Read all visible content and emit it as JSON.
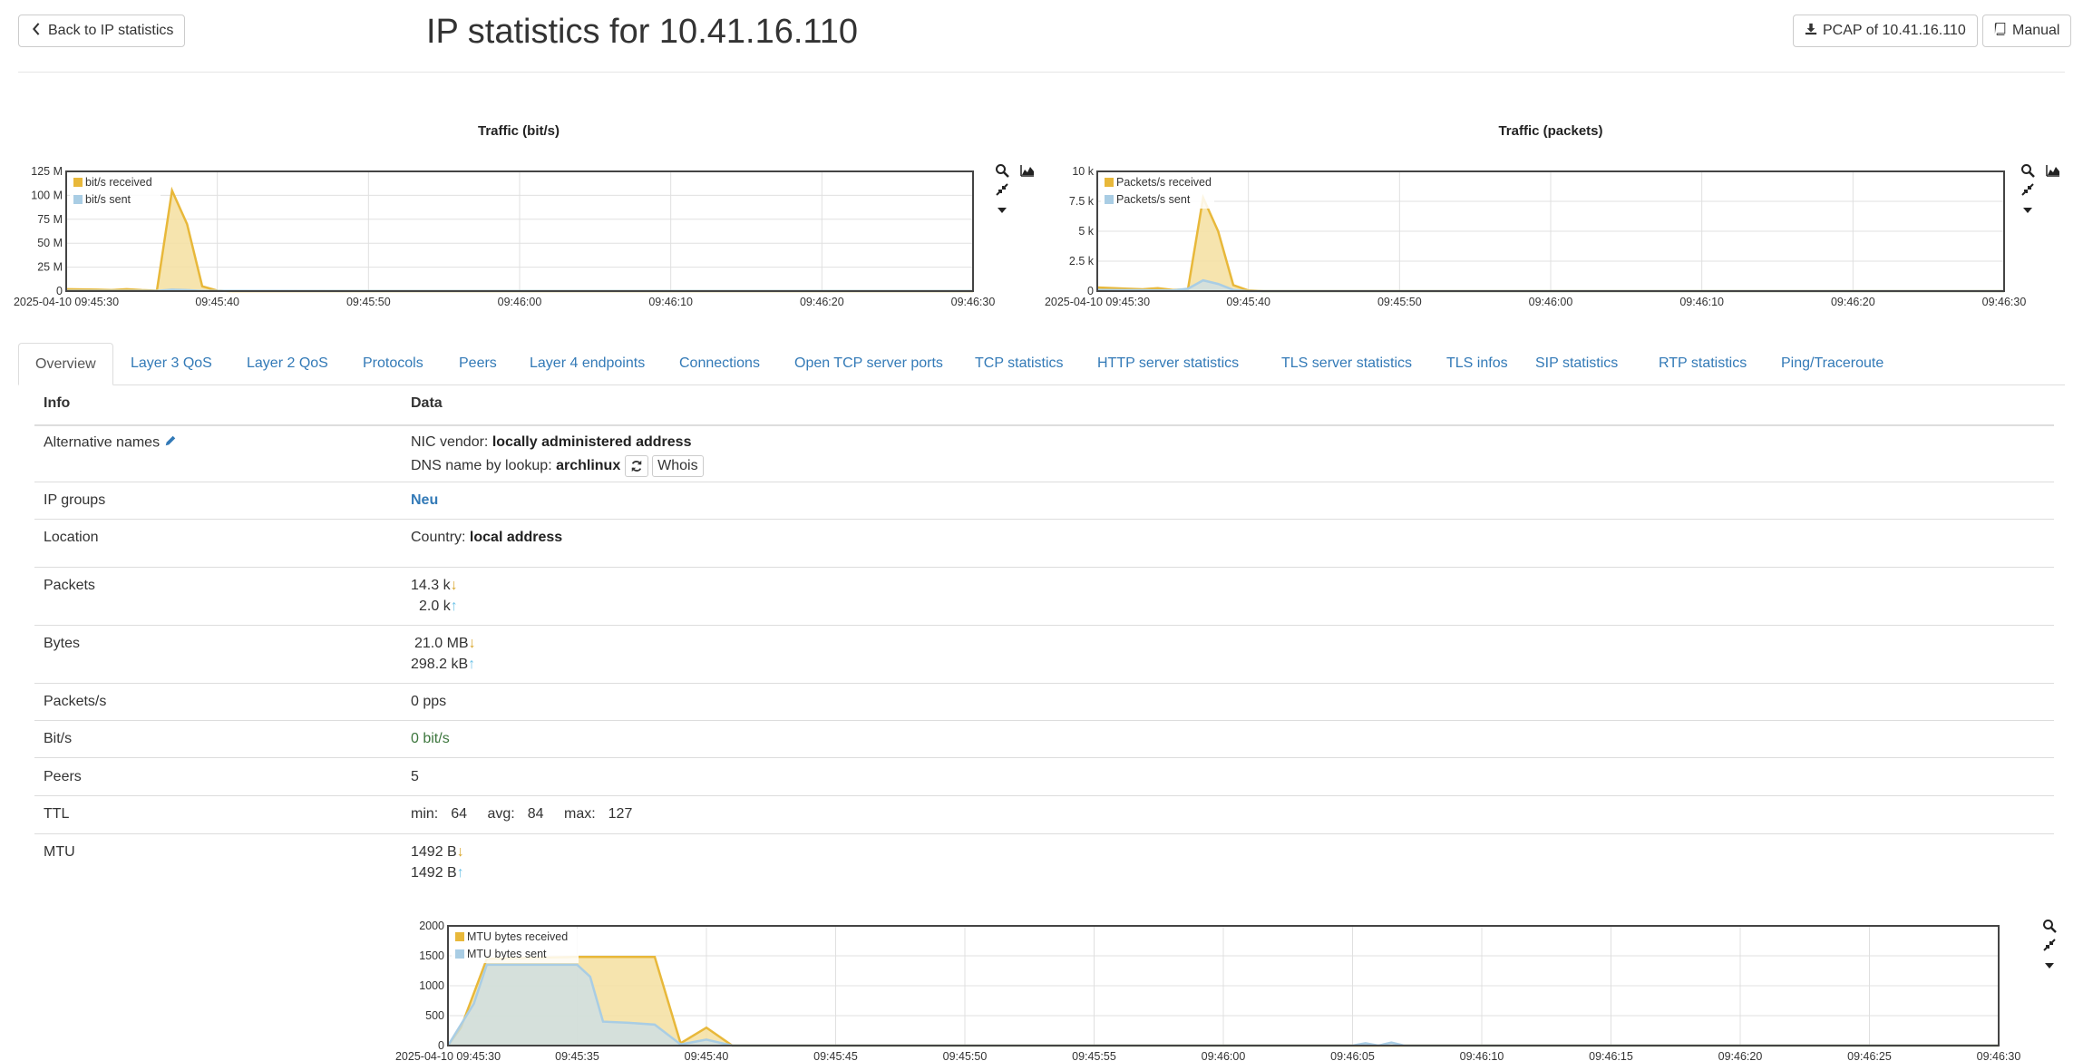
{
  "header": {
    "back_label": "Back to IP statistics",
    "title": "IP statistics for 10.41.16.110",
    "pcap_label": "PCAP of 10.41.16.110",
    "manual_label": "Manual"
  },
  "tabs": [
    {
      "label": "Overview",
      "active": true
    },
    {
      "label": "Layer 3 QoS"
    },
    {
      "label": "Layer 2 QoS"
    },
    {
      "label": "Protocols"
    },
    {
      "label": "Peers"
    },
    {
      "label": "Layer 4 endpoints"
    },
    {
      "label": "Connections"
    },
    {
      "label": "Open TCP server ports"
    },
    {
      "label": "TCP statistics"
    },
    {
      "label": "HTTP server statistics"
    },
    {
      "label": "TLS server statistics"
    },
    {
      "label": "TLS infos"
    },
    {
      "label": "SIP statistics"
    },
    {
      "label": "RTP statistics"
    },
    {
      "label": "Ping/Traceroute"
    }
  ],
  "table": {
    "head_info": "Info",
    "head_data": "Data",
    "alt_names": {
      "label": "Alternative names",
      "nic_prefix": "NIC vendor:",
      "nic_value": "locally administered address",
      "dns_prefix": "DNS name by lookup:",
      "dns_value": "archlinux",
      "whois_label": "Whois"
    },
    "ip_groups": {
      "label": "IP groups",
      "value": "Neu"
    },
    "location": {
      "label": "Location",
      "prefix": "Country:",
      "value": "local address"
    },
    "packets": {
      "label": "Packets",
      "received": "14.3 k",
      "sent": "2.0 k"
    },
    "bytes": {
      "label": "Bytes",
      "received": "21.0 MB",
      "sent": "298.2 kB"
    },
    "packets_per_s": {
      "label": "Packets/s",
      "value": "0 pps"
    },
    "bits_per_s": {
      "label": "Bit/s",
      "value": "0 bit/s"
    },
    "peers": {
      "label": "Peers",
      "value": "5"
    },
    "ttl": {
      "label": "TTL",
      "min_label": "min:",
      "min": "64",
      "avg_label": "avg:",
      "avg": "84",
      "max_label": "max:",
      "max": "127"
    },
    "mtu": {
      "label": "MTU",
      "received": "1492 B",
      "sent": "1492 B"
    }
  },
  "colors": {
    "received": "#e8b83a",
    "received_fill": "#f5dfa0",
    "sent": "#a9cde4",
    "sent_fill": "#c9dfea",
    "link": "#337ab7"
  },
  "chart_data": [
    {
      "type": "area",
      "title": "Traffic (bit/s)",
      "x_tick_labels": [
        "2025-04-10 09:45:30",
        "09:45:40",
        "09:45:50",
        "09:46:00",
        "09:46:10",
        "09:46:20",
        "09:46:30"
      ],
      "y_tick_labels": [
        "0",
        "25 M",
        "50 M",
        "75 M",
        "100 M",
        "125 M"
      ],
      "ylim": [
        0,
        125000000
      ],
      "x_seconds_range": [
        0,
        60
      ],
      "series": [
        {
          "name": "bit/s received",
          "color": "#e8b83a",
          "points": [
            [
              0,
              2000000
            ],
            [
              2,
              1500000
            ],
            [
              3,
              1000000
            ],
            [
              4,
              2000000
            ],
            [
              5,
              1000000
            ],
            [
              6,
              500000
            ],
            [
              7,
              105000000
            ],
            [
              8,
              70000000
            ],
            [
              9,
              5000000
            ],
            [
              10,
              500000
            ],
            [
              11,
              0
            ],
            [
              60,
              0
            ]
          ]
        },
        {
          "name": "bit/s sent",
          "color": "#a9cde4",
          "points": [
            [
              0,
              300000
            ],
            [
              6,
              200000
            ],
            [
              7,
              1500000
            ],
            [
              8,
              1000000
            ],
            [
              9,
              200000
            ],
            [
              60,
              100000
            ]
          ]
        }
      ]
    },
    {
      "type": "area",
      "title": "Traffic (packets)",
      "x_tick_labels": [
        "2025-04-10 09:45:30",
        "09:45:40",
        "09:45:50",
        "09:46:00",
        "09:46:10",
        "09:46:20",
        "09:46:30"
      ],
      "y_tick_labels": [
        "0",
        "2.5 k",
        "5 k",
        "7.5 k",
        "10 k"
      ],
      "ylim": [
        0,
        10000
      ],
      "x_seconds_range": [
        0,
        60
      ],
      "series": [
        {
          "name": "Packets/s received",
          "color": "#e8b83a",
          "points": [
            [
              0,
              300
            ],
            [
              2,
              200
            ],
            [
              3,
              150
            ],
            [
              4,
              250
            ],
            [
              5,
              100
            ],
            [
              6,
              150
            ],
            [
              7,
              7800
            ],
            [
              8,
              5000
            ],
            [
              9,
              500
            ],
            [
              10,
              50
            ],
            [
              11,
              0
            ],
            [
              60,
              0
            ]
          ]
        },
        {
          "name": "Packets/s sent",
          "color": "#a9cde4",
          "points": [
            [
              0,
              100
            ],
            [
              5,
              50
            ],
            [
              6,
              200
            ],
            [
              7,
              900
            ],
            [
              8,
              600
            ],
            [
              9,
              100
            ],
            [
              10,
              0
            ],
            [
              60,
              0
            ]
          ]
        }
      ]
    },
    {
      "type": "area",
      "title": "",
      "x_tick_labels": [
        "2025-04-10 09:45:30",
        "09:45:35",
        "09:45:40",
        "09:45:45",
        "09:45:50",
        "09:45:55",
        "09:46:00",
        "09:46:05",
        "09:46:10",
        "09:46:15",
        "09:46:20",
        "09:46:25",
        "09:46:30"
      ],
      "y_tick_labels": [
        "0",
        "500",
        "1000",
        "1500",
        "2000"
      ],
      "ylim": [
        0,
        2000
      ],
      "x_seconds_range": [
        0,
        60
      ],
      "series": [
        {
          "name": "MTU bytes received",
          "color": "#e8b83a",
          "points": [
            [
              0,
              0
            ],
            [
              0.5,
              300
            ],
            [
              1.5,
              1450
            ],
            [
              5,
              1480
            ],
            [
              7,
              1480
            ],
            [
              8,
              1480
            ],
            [
              9,
              40
            ],
            [
              10,
              300
            ],
            [
              11,
              0
            ],
            [
              60,
              0
            ]
          ]
        },
        {
          "name": "MTU bytes sent",
          "color": "#a9cde4",
          "points": [
            [
              0,
              0
            ],
            [
              1,
              700
            ],
            [
              1.5,
              1350
            ],
            [
              5,
              1350
            ],
            [
              5.5,
              1150
            ],
            [
              6,
              400
            ],
            [
              7,
              380
            ],
            [
              8,
              350
            ],
            [
              9,
              20
            ],
            [
              10,
              100
            ],
            [
              11,
              0
            ],
            [
              35,
              0
            ],
            [
              35.5,
              40
            ],
            [
              36,
              0
            ],
            [
              36.5,
              50
            ],
            [
              37,
              0
            ],
            [
              60,
              0
            ]
          ]
        }
      ]
    }
  ]
}
